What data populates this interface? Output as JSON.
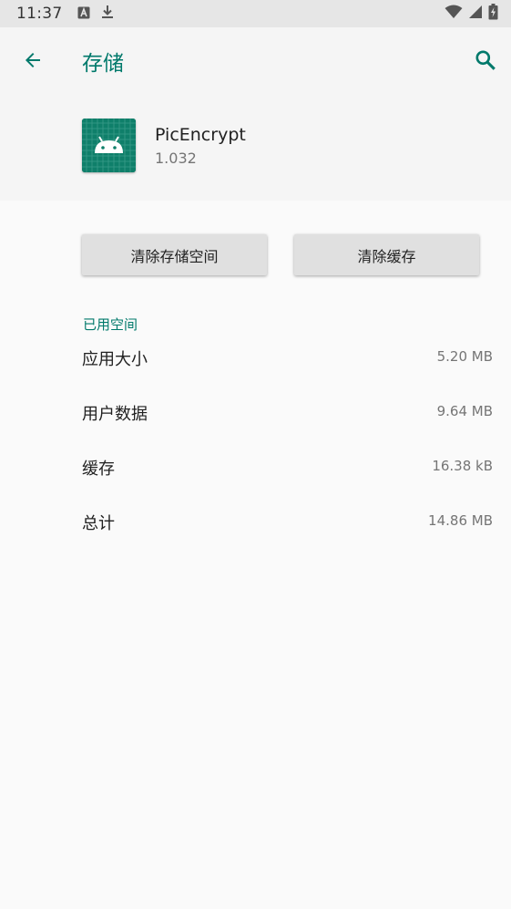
{
  "status_bar": {
    "time": "11:37",
    "icons": [
      "keyboard-a-icon",
      "download-icon",
      "wifi-icon",
      "signal-icon",
      "battery-charging-icon"
    ]
  },
  "app_bar": {
    "title": "存储",
    "icons": [
      "arrow-back-icon",
      "search-icon"
    ],
    "accent_color": "#00796b"
  },
  "app_info": {
    "name": "PicEncrypt",
    "version": "1.032",
    "icon": "android-robot-icon",
    "icon_color": "#0f7f6a"
  },
  "actions": {
    "clear_storage": "清除存储空间",
    "clear_cache": "清除缓存"
  },
  "storage": {
    "section_title": "已用空间",
    "rows": [
      {
        "label": "应用大小",
        "value": "5.20 MB"
      },
      {
        "label": "用户数据",
        "value": "9.64 MB"
      },
      {
        "label": "缓存",
        "value": "16.38 kB"
      },
      {
        "label": "总计",
        "value": "14.86 MB"
      }
    ]
  }
}
